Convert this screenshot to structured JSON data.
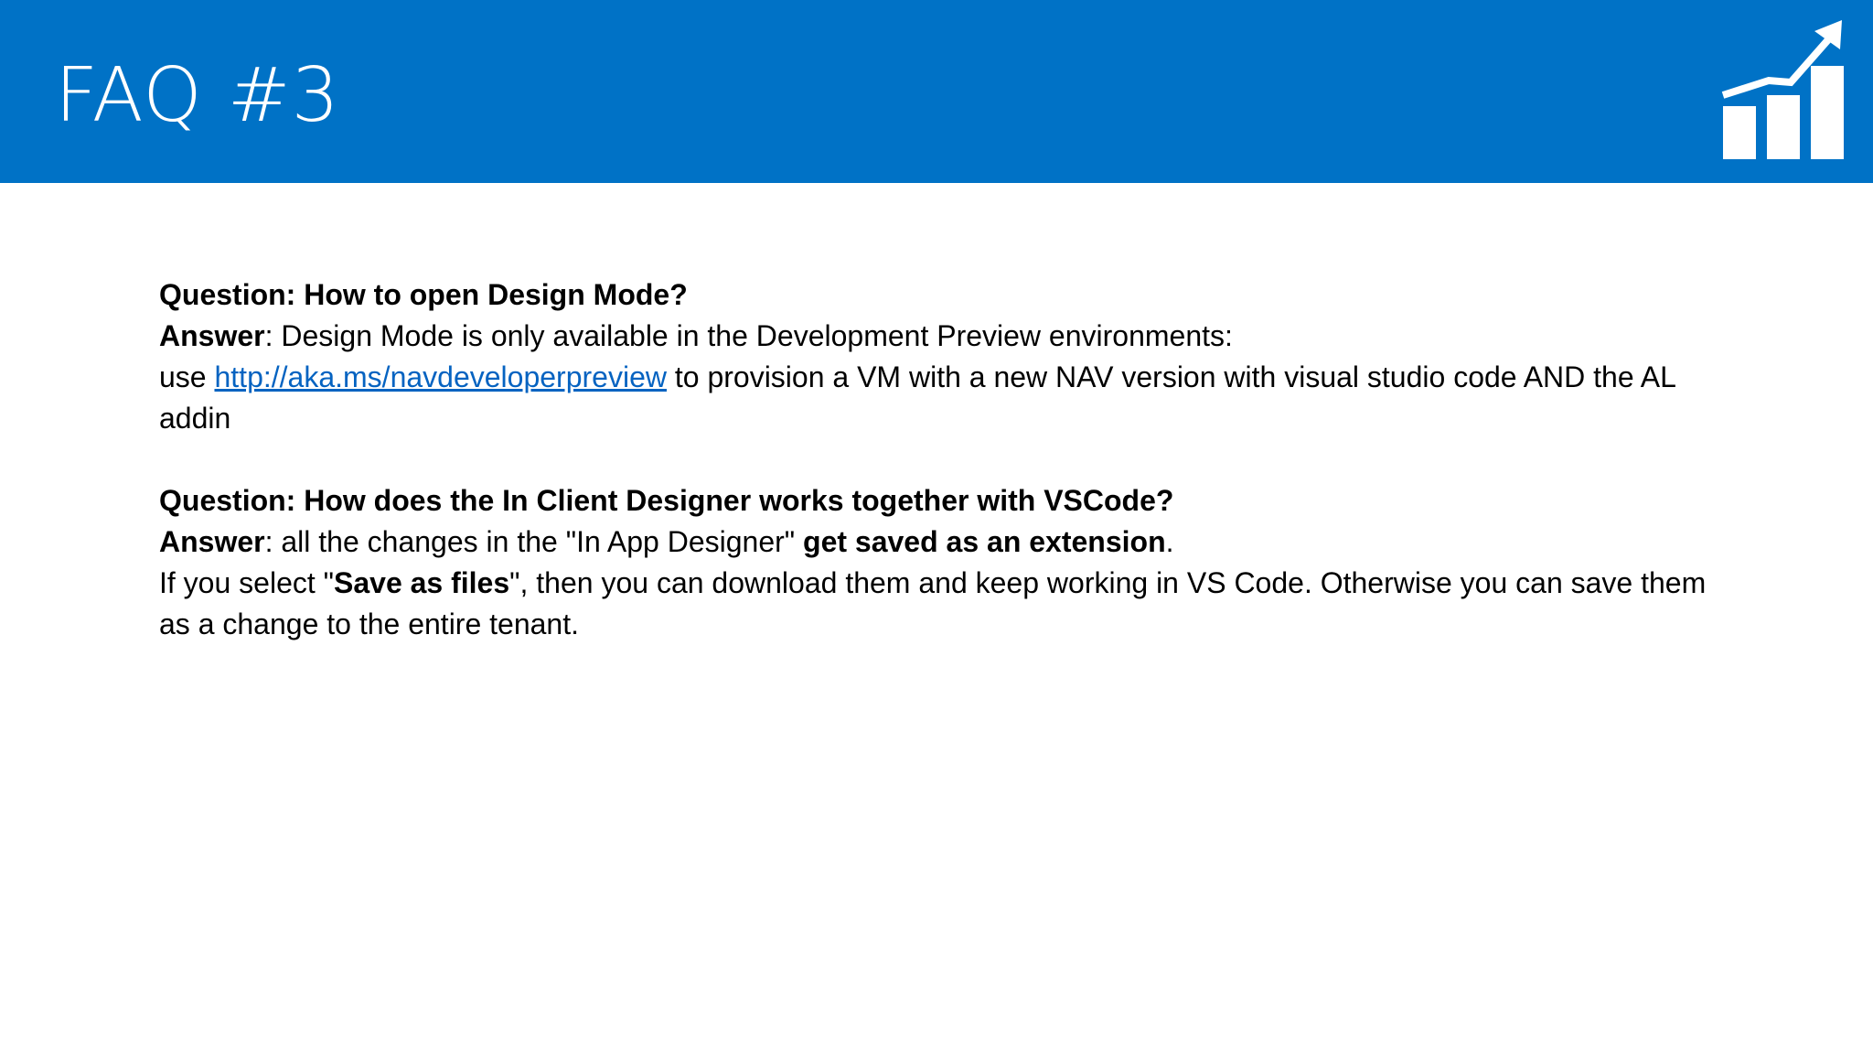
{
  "slide": {
    "title": "FAQ #3",
    "icon": "rising-bar-chart-icon",
    "colors": {
      "header": "#0072C6",
      "link": "#0563C1"
    }
  },
  "faq": [
    {
      "question": "Question: How to open Design Mode?",
      "answer_label": "Answer",
      "answer_text": ": Design Mode is only available in the Development Preview environments:",
      "detail_prefix": "use ",
      "detail_link": "http://aka.ms/navdeveloperpreview",
      "detail_suffix": " to provision a VM with a new NAV version with visual studio code AND the AL addin"
    },
    {
      "question": "Question: How does the In Client Designer works together with VSCode?",
      "answer_label": "Answer",
      "answer_text": ": all the changes in the \"In App Designer\" ",
      "answer_bold": "get saved as an extension",
      "answer_end": ".",
      "detail_prefix": "If you select \"",
      "detail_bold": "Save as files",
      "detail_suffix": "\", then you can download them and keep working in VS Code. Otherwise you can save them as a change to the entire tenant."
    }
  ]
}
